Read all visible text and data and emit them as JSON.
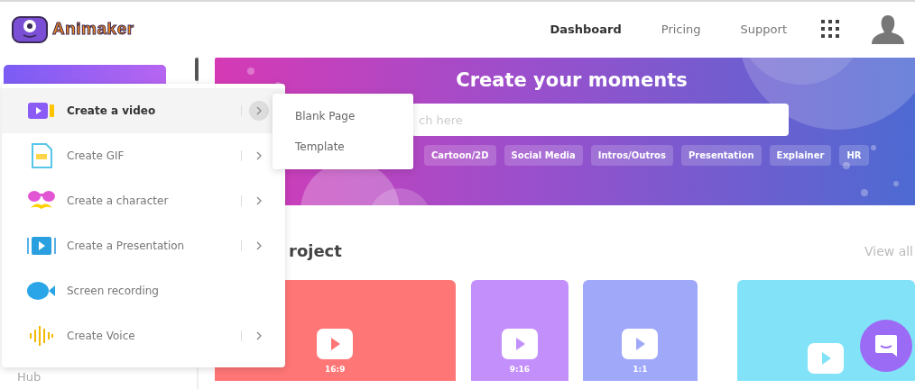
{
  "header": {
    "logo": "Animaker",
    "nav": [
      {
        "label": "Dashboard",
        "selected": true
      },
      {
        "label": "Pricing",
        "selected": false
      },
      {
        "label": "Support",
        "selected": false
      }
    ]
  },
  "sidebar": {
    "items": [
      "Hub"
    ]
  },
  "banner": {
    "title": "Create your moments",
    "search": {
      "placeholder": "ch here"
    },
    "chips": [
      "Cartoon/2D",
      "Social Media",
      "Intros/Outros",
      "Presentation",
      "Explainer",
      "HR"
    ]
  },
  "projects": {
    "heading": "roject",
    "link": "View all",
    "cards": [
      {
        "label": "16:9",
        "color": "#ff7676"
      },
      {
        "label": "9:16",
        "color": "#c390fb"
      },
      {
        "label": "1:1",
        "color": "#a0a8fa"
      },
      {
        "color": "#82e3f8"
      }
    ]
  },
  "create_menu": {
    "items": [
      {
        "kind": "video",
        "label": "Create a video",
        "submenu": true,
        "selected": true
      },
      {
        "kind": "gif",
        "label": "Create GIF",
        "submenu": true,
        "selected": false
      },
      {
        "kind": "character",
        "label": "Create a character",
        "submenu": true,
        "selected": false
      },
      {
        "kind": "presentation",
        "label": "Create a Presentation",
        "submenu": true,
        "selected": false
      },
      {
        "kind": "recording",
        "label": "Screen recording",
        "submenu": false,
        "selected": false
      },
      {
        "kind": "voice",
        "label": "Create Voice",
        "submenu": true,
        "selected": false
      }
    ],
    "submenu": [
      "Blank Page",
      "Template"
    ]
  }
}
